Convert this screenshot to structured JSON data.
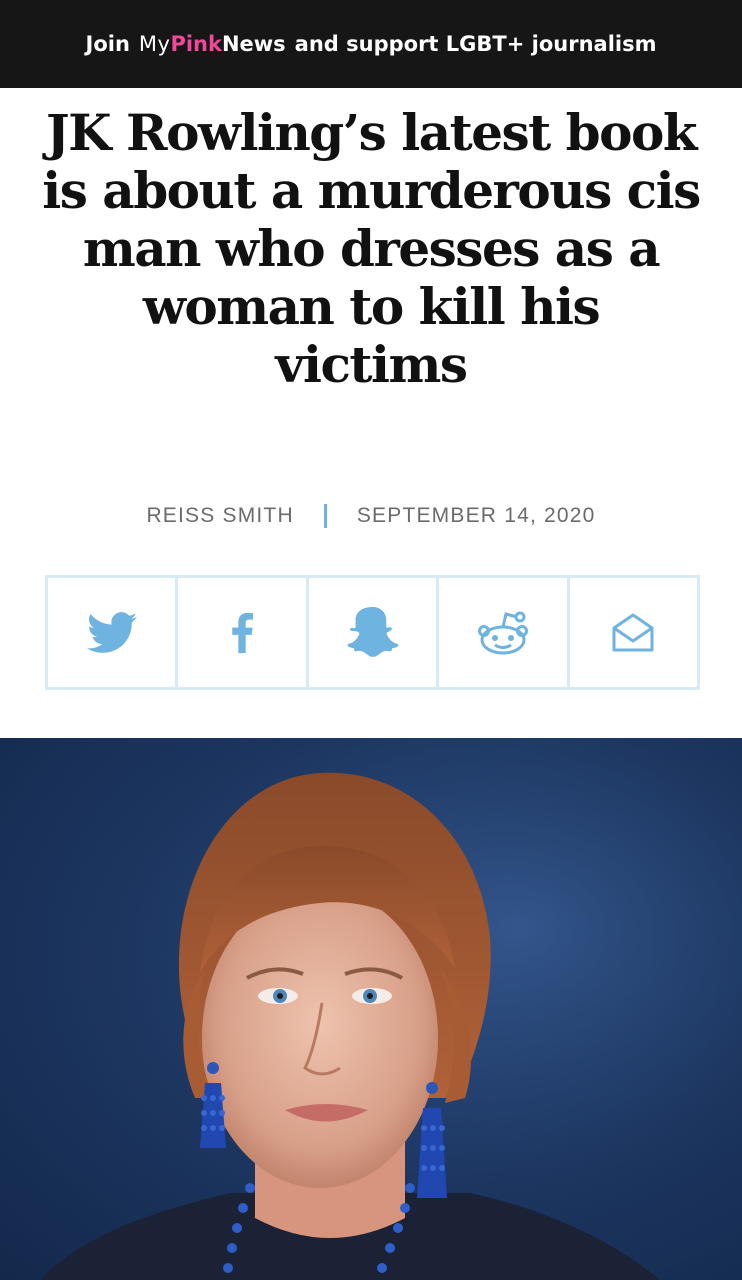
{
  "banner": {
    "join": "Join",
    "brand_my": "My",
    "brand_pink": "Pink",
    "brand_news": "News",
    "support": "and support LGBT+ journalism"
  },
  "article": {
    "headline": "JK Rowling’s latest book is about a murderous cis man who dresses as a woman to kill his victims",
    "author": "REISS SMITH",
    "date": "SEPTEMBER 14, 2020"
  },
  "share": {
    "icon_color": "#6fb3e0",
    "border_color": "#d8eaf6",
    "buttons": [
      {
        "icon": "twitter-icon"
      },
      {
        "icon": "facebook-icon"
      },
      {
        "icon": "snapchat-icon"
      },
      {
        "icon": "reddit-icon"
      },
      {
        "icon": "email-icon"
      }
    ]
  },
  "colors": {
    "banner_bg": "#161616",
    "brand_pink": "#f0489a",
    "headline": "#111111",
    "byline": "#6b6b6b",
    "photo_background": "#1c355f"
  },
  "hero_image": {
    "subject": "portrait photo of a red-haired woman with blue earrings against a blue backdrop"
  }
}
